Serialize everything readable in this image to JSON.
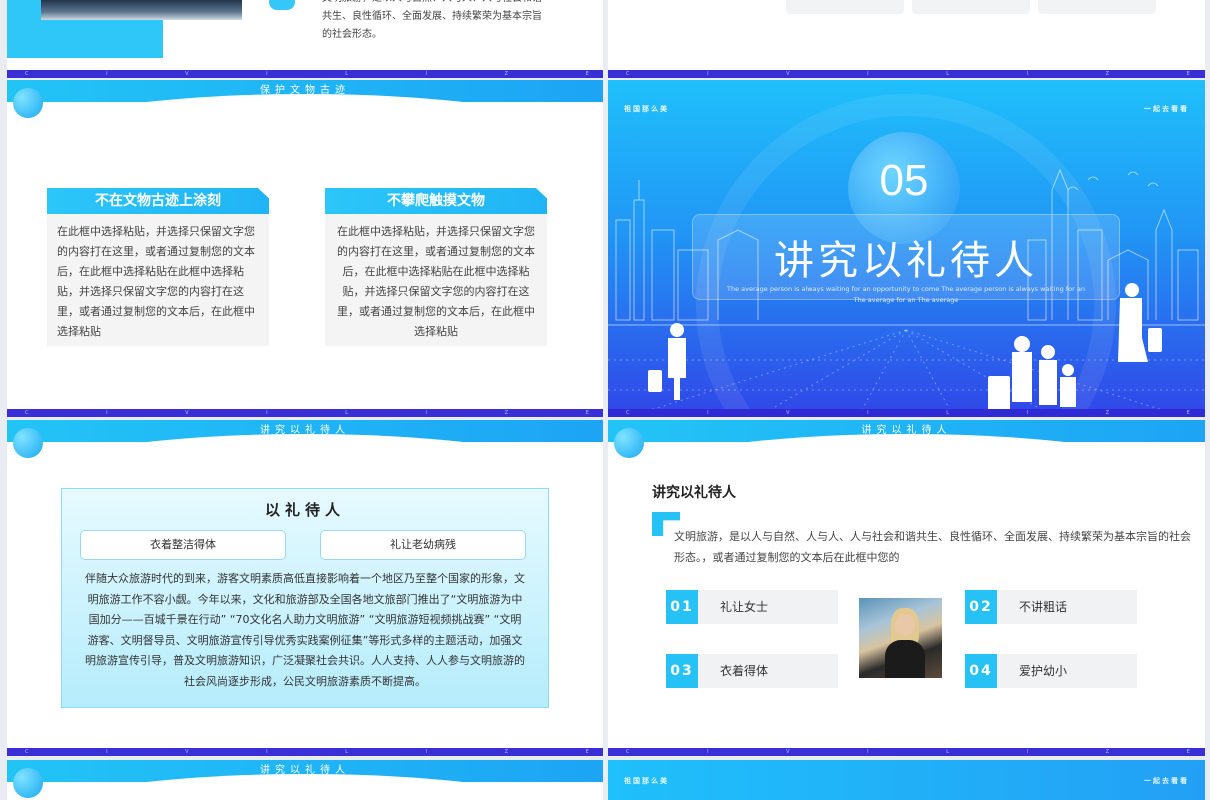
{
  "band_text": "C I V I L I Z E D   L I F E   A N D   H A P P Y   T R A V E L",
  "slide1": {
    "lines": [
      "文明旅游，是以人与自然、人与人、人与社会和谐",
      "共生、良性循环、全面发展、持续繁荣为基本宗旨",
      "的社会形态。"
    ]
  },
  "slide3": {
    "topbar": "保护文物古迹",
    "boxes": [
      {
        "title": "不在文物古迹上涂刻",
        "body": "在此框中选择粘贴，并选择只保留文字您的内容打在这里，或者通过复制您的文本后，在此框中选择粘贴在此框中选择粘贴，并选择只保留文字您的内容打在这里，或者通过复制您的文本后，在此框中选择粘贴"
      },
      {
        "title": "不攀爬触摸文物",
        "body": "在此框中选择粘贴，并选择只保留文字您的内容打在这里，或者通过复制您的文本后，在此框中选择粘贴在此框中选择粘贴，并选择只保留文字您的内容打在这里，或者通过复制您的文本后，在此框中选择粘贴"
      }
    ]
  },
  "slide4": {
    "left_corner": "祖国那么美",
    "right_corner": "一起去看看",
    "number": "05",
    "title": "讲究以礼待人",
    "subtitle": "The average person is always waiting for an opportunity to come The average person is always waiting for an The average for an The average"
  },
  "slide5": {
    "topbar": "讲究以礼待人",
    "panel_title": "以礼待人",
    "pills": [
      "衣着整洁得体",
      "礼让老幼病残"
    ],
    "paragraph": "伴随大众旅游时代的到来，游客文明素质高低直接影响着一个地区乃至整个国家的形象，文明旅游工作不容小觑。今年以来，文化和旅游部及全国各地文旅部门推出了“文明旅游为中国加分——百城千景在行动” “70文化名人助力文明旅游” “文明旅游短视频挑战赛” “文明游客、文明督导员、文明旅游宣传引导优秀实践案例征集”等形式多样的主题活动，加强文明旅游宣传引导，普及文明旅游知识，广泛凝聚社会共识。人人支持、人人参与文明旅游的社会风尚逐步形成，公民文明旅游素质不断提高。"
  },
  "slide6": {
    "topbar": "讲究以礼待人",
    "heading": "讲究以礼待人",
    "description": "文明旅游，是以人与自然、人与人、人与社会和谐共生、良性循环、全面发展、持续繁荣为基本宗旨的社会形态。，或者通过复制您的文本后在此框中您的",
    "items": [
      {
        "num": "01",
        "text": "礼让女士"
      },
      {
        "num": "02",
        "text": "不讲粗话"
      },
      {
        "num": "03",
        "text": "衣着得体"
      },
      {
        "num": "04",
        "text": "爱护幼小"
      }
    ]
  },
  "slide7": {
    "topbar": "讲究以礼待人"
  },
  "slide8": {
    "left_corner": "祖国那么美",
    "right_corner": "一起去看看"
  }
}
